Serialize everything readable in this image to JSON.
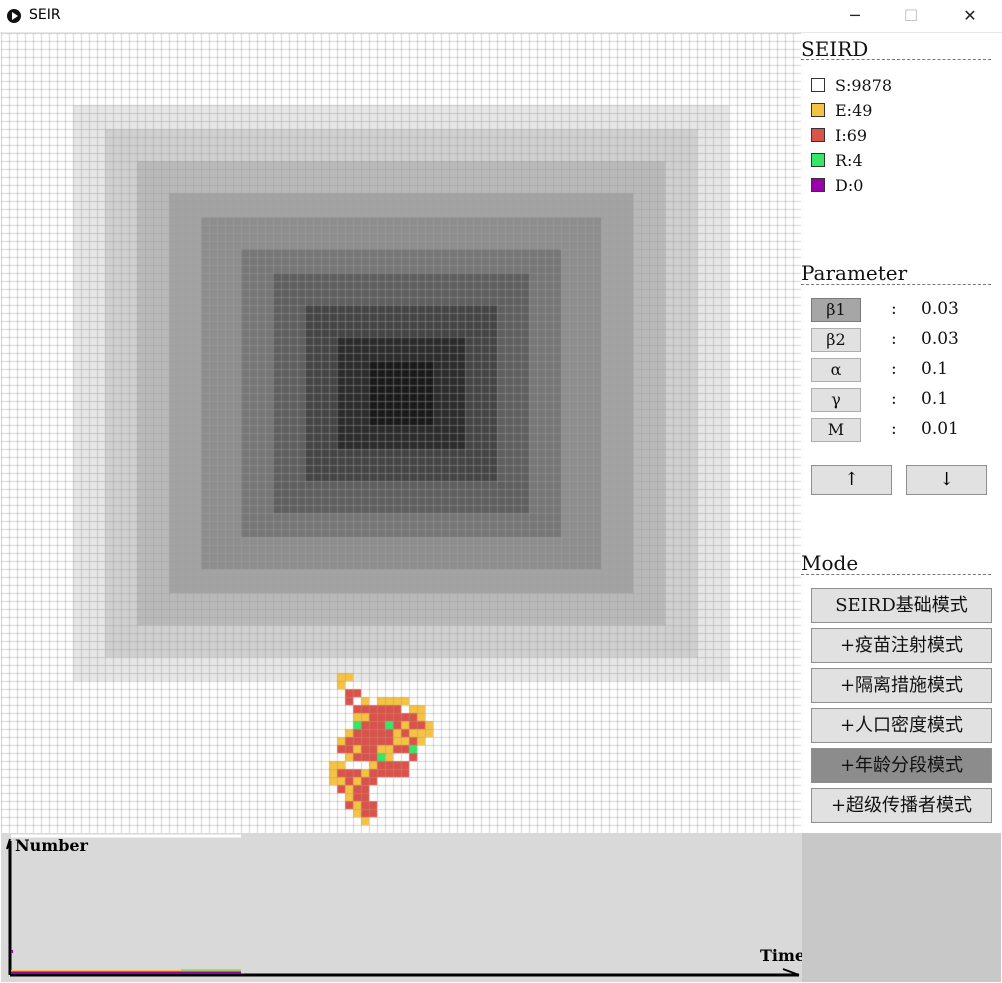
{
  "window": {
    "title": "SEIR",
    "minimize_glyph": "─",
    "maximize_glyph": "☐",
    "close_glyph": "✕"
  },
  "grid": {
    "cell_counts_note": "",
    "colors": {
      "susceptible": "#ffffff",
      "exposed": "#f5c242",
      "infected": "#d9534a",
      "recovered": "#33e866",
      "dead": "#9900aa",
      "gridline": "#d0d0d0"
    },
    "density_shades": [
      "#ffffff",
      "#e6e6e6",
      "#d0d0d0",
      "#b9b9b9",
      "#a3a3a3",
      "#8e8e8e",
      "#777777",
      "#5f5f5f",
      "#454545",
      "#2c2c2c",
      "#1a1a1a"
    ]
  },
  "seird": {
    "title": "SEIRD",
    "items": [
      {
        "label": "S:9878",
        "color": "#ffffff"
      },
      {
        "label": "E:49",
        "color": "#f5c242"
      },
      {
        "label": "I:69",
        "color": "#d9534a"
      },
      {
        "label": "R:4",
        "color": "#33e866"
      },
      {
        "label": "D:0",
        "color": "#9900aa"
      }
    ]
  },
  "parameter": {
    "title": "Parameter",
    "items": [
      {
        "name": "β1",
        "colon": ":",
        "value": "0.03",
        "selected": true
      },
      {
        "name": "β2",
        "colon": ":",
        "value": "0.03",
        "selected": false
      },
      {
        "name": "α",
        "colon": ":",
        "value": "0.1",
        "selected": false
      },
      {
        "name": "γ",
        "colon": ":",
        "value": "0.1",
        "selected": false
      },
      {
        "name": "M",
        "colon": ":",
        "value": "0.01",
        "selected": false
      }
    ],
    "up_glyph": "↑",
    "down_glyph": "↓"
  },
  "mode": {
    "title": "Mode",
    "items": [
      {
        "label": "SEIRD基础模式",
        "active": false
      },
      {
        "label": "+疫苗注射模式",
        "active": false
      },
      {
        "label": "+隔离措施模式",
        "active": false
      },
      {
        "label": "+人口密度模式",
        "active": false
      },
      {
        "label": "+年龄分段模式",
        "active": true
      },
      {
        "label": "+超级传播者模式",
        "active": false
      }
    ]
  },
  "chart": {
    "ylabel": "Number",
    "xlabel": "Time"
  }
}
